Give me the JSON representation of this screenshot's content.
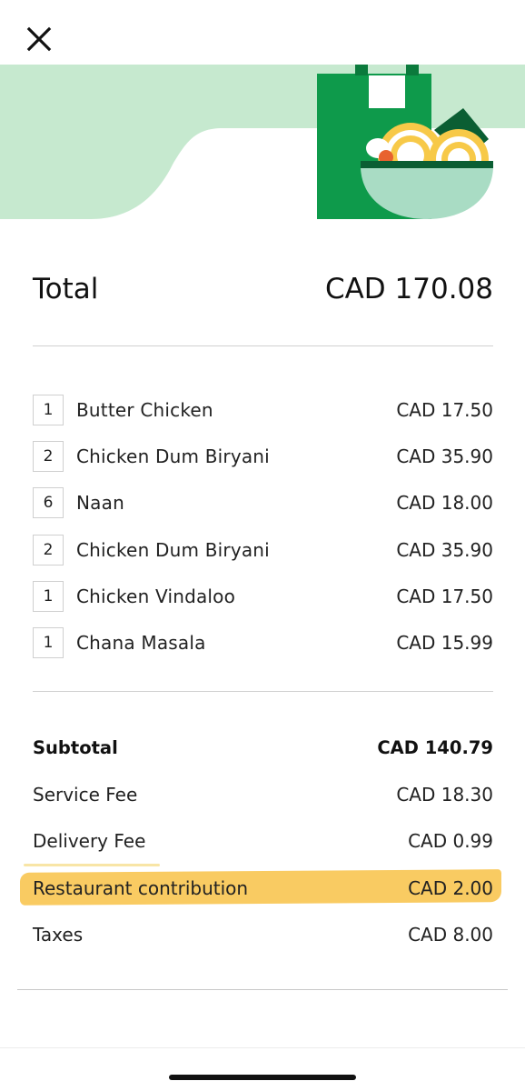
{
  "header": {
    "close_icon": "close-icon",
    "banner_illustration": "food-bag-noodle-bowl-illustration",
    "colors": {
      "banner_bg": "#c6e9cf",
      "bag_green": "#0e9a4b",
      "bowl_mint": "#a9dcc4",
      "noodle_yellow": "#f7c948"
    }
  },
  "total": {
    "label": "Total",
    "value": "CAD 170.08"
  },
  "items": [
    {
      "qty": "1",
      "name": "Butter Chicken",
      "price": "CAD 17.50"
    },
    {
      "qty": "2",
      "name": "Chicken Dum Biryani",
      "price": "CAD 35.90"
    },
    {
      "qty": "6",
      "name": "Naan",
      "price": "CAD 18.00"
    },
    {
      "qty": "2",
      "name": "Chicken Dum Biryani",
      "price": "CAD 35.90"
    },
    {
      "qty": "1",
      "name": "Chicken Vindaloo",
      "price": "CAD 17.50"
    },
    {
      "qty": "1",
      "name": "Chana Masala",
      "price": "CAD 15.99"
    }
  ],
  "summary": [
    {
      "label": "Subtotal",
      "value": "CAD 140.79"
    },
    {
      "label": "Service Fee",
      "value": "CAD 18.30"
    },
    {
      "label": "Delivery Fee",
      "value": "CAD 0.99"
    },
    {
      "label": "Restaurant contribution",
      "value": "CAD 2.00"
    },
    {
      "label": "Taxes",
      "value": "CAD 8.00"
    }
  ],
  "highlight_color": "#f8c247"
}
